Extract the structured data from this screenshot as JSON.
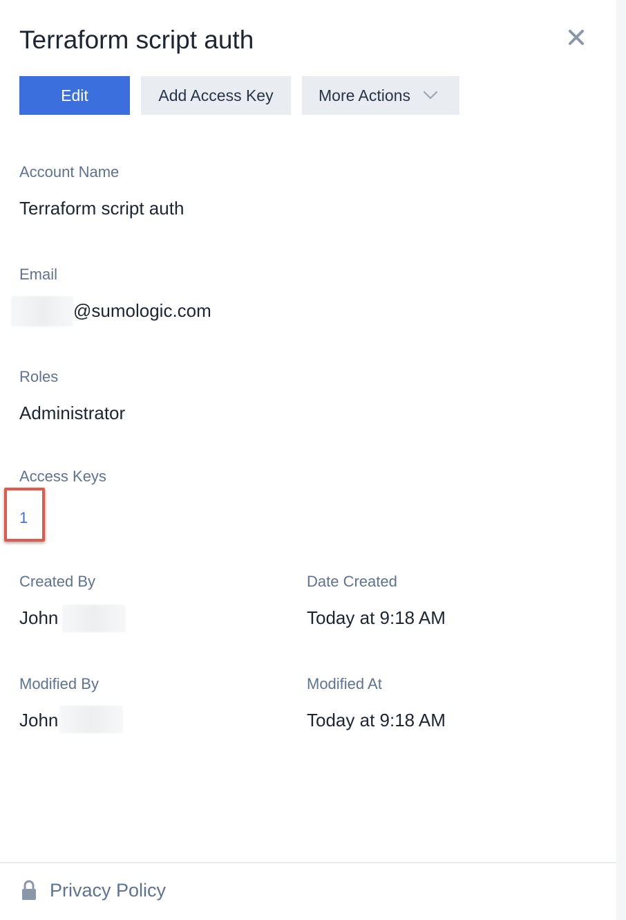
{
  "panel": {
    "title": "Terraform script auth",
    "close_icon": "close-icon"
  },
  "actions": {
    "edit_label": "Edit",
    "add_access_key_label": "Add Access Key",
    "more_actions_label": "More Actions",
    "more_actions_icon": "chevron-down-icon"
  },
  "fields": {
    "account_name": {
      "label": "Account Name",
      "value": "Terraform script auth"
    },
    "email": {
      "label": "Email",
      "value": "@sumologic.com"
    },
    "roles": {
      "label": "Roles",
      "value": "Administrator"
    },
    "access_keys": {
      "label": "Access Keys",
      "value": "1"
    },
    "created_by": {
      "label": "Created By",
      "value": "John"
    },
    "date_created": {
      "label": "Date Created",
      "value": "Today at 9:18 AM"
    },
    "modified_by": {
      "label": "Modified By",
      "value": "John"
    },
    "modified_at": {
      "label": "Modified At",
      "value": "Today at 9:18 AM"
    }
  },
  "footer": {
    "privacy_label": "Privacy Policy",
    "lock_icon": "lock-icon"
  },
  "colors": {
    "primary": "#3b6fdd",
    "secondary_button": "#e9edf2",
    "label": "#5d7391",
    "highlight": "#e0594b"
  }
}
